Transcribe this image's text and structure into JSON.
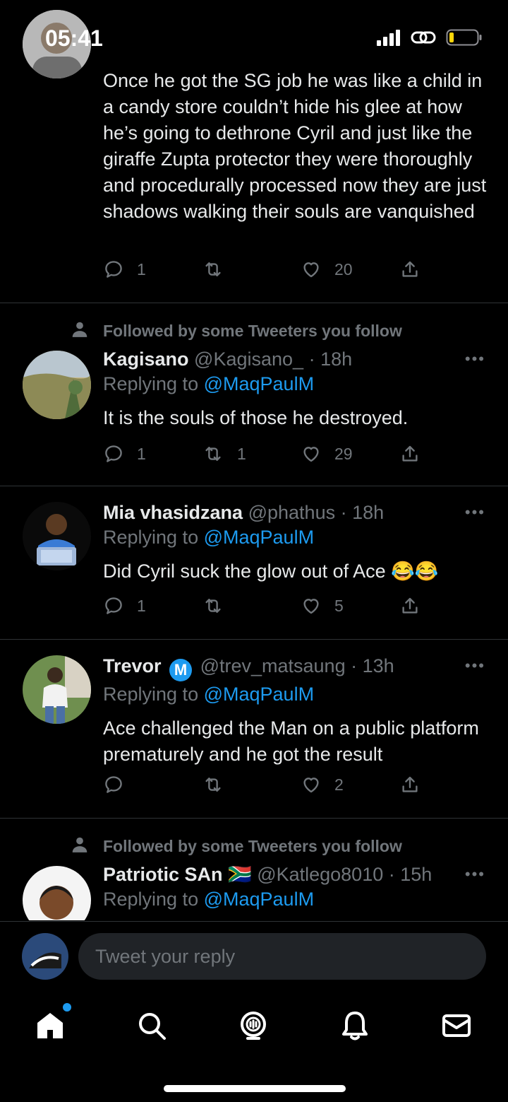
{
  "status_bar": {
    "time": "05:41"
  },
  "tweets": [
    {
      "text": "Once he got the SG job he was like a child in a candy store couldn’t hide his glee at how he’s going to dethrone Cyril and just like the giraffe Zupta protector they were thoroughly and procedurally processed now they are just shadows walking their souls are vanquished",
      "replies": "1",
      "retweets": "",
      "likes": "20"
    },
    {
      "social_context": "Followed by some Tweeters you follow",
      "name": "Kagisano",
      "handle": "@Kagisano_",
      "time": "· 18h",
      "replying_prefix": "Replying to ",
      "replying_to": "@MaqPaulM",
      "text": "It is the souls of those he destroyed.",
      "replies": "1",
      "retweets": "1",
      "likes": "29"
    },
    {
      "name": "Mia vhasidzana",
      "handle": "@phathus",
      "time": "· 18h",
      "replying_prefix": "Replying to ",
      "replying_to": "@MaqPaulM",
      "text": "Did Cyril suck the glow out of Ace 😂😂",
      "replies": "1",
      "retweets": "",
      "likes": "5"
    },
    {
      "name": "Trevor",
      "badge": "M",
      "handle": "@trev_matsaung",
      "time": "· 13h",
      "replying_prefix": "Replying to ",
      "replying_to": "@MaqPaulM",
      "text": "Ace challenged the Man on a public platform prematurely and he got the result",
      "replies": "",
      "retweets": "",
      "likes": "2"
    },
    {
      "social_context": "Followed by some Tweeters you follow",
      "name": "Patriotic SAn",
      "flag": "🇿🇦",
      "handle": "@Katlego8010",
      "time": "· 15h",
      "replying_prefix": "Replying to ",
      "replying_to": "@MaqPaulM"
    }
  ],
  "more_label": "•••",
  "reply_bar": {
    "placeholder": "Tweet your reply"
  },
  "tabs": [
    {
      "icon": "home-icon",
      "has_dot": true
    },
    {
      "icon": "search-icon"
    },
    {
      "icon": "spaces-icon"
    },
    {
      "icon": "notifications-icon"
    },
    {
      "icon": "messages-icon"
    }
  ],
  "colors": {
    "background": "#000000",
    "text": "#e7e9ea",
    "muted": "#71767b",
    "accent": "#1d9bf0",
    "divider": "#2f3336"
  }
}
